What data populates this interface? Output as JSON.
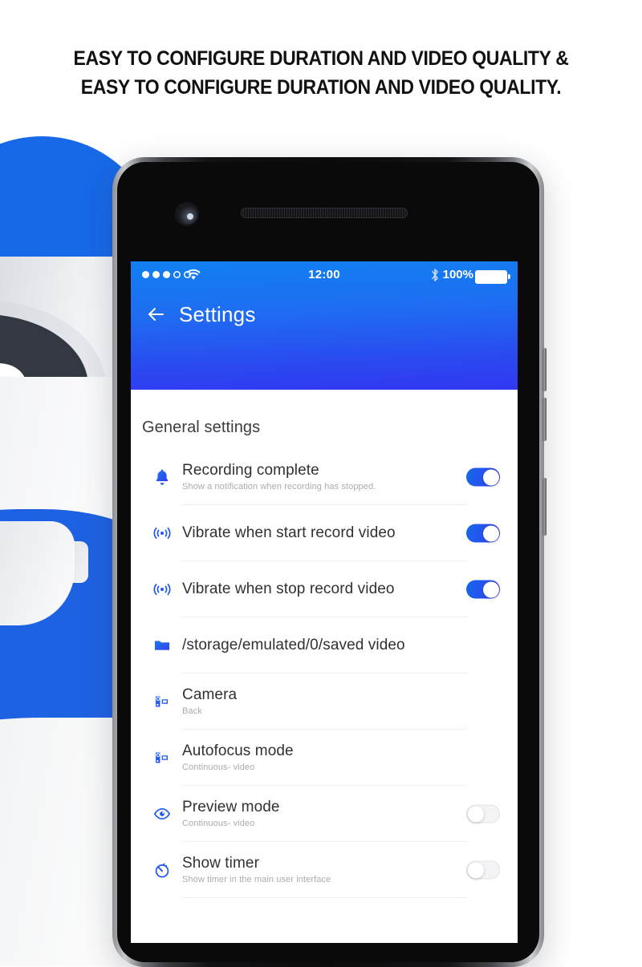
{
  "headline": {
    "line1": "EASY TO CONFIGURE DURATION AND VIDEO QUALITY &",
    "line2": "EASY TO CONFIGURE DURATION AND VIDEO QUALITY."
  },
  "colors": {
    "accent_start": "#1180f2",
    "accent_end": "#3137f2",
    "icon_blue": "#1e56ee",
    "toggle_on": "#2a4df0",
    "toggle_off": "#f3f4f6",
    "title_text": "#2f3135",
    "subtitle_text": "#a9abb0",
    "separator": "#eceef1",
    "mascot_blue": "#1769e8"
  },
  "status_bar": {
    "signal_filled": 3,
    "signal_empty": 2,
    "wifi_icon": "wifi-icon",
    "time": "12:00",
    "bluetooth_icon": "bluetooth-icon",
    "battery_percent": "100%",
    "battery_icon": "battery-full-icon"
  },
  "header": {
    "back_icon": "back-arrow-icon",
    "title": "Settings"
  },
  "settings": {
    "section_title": "General settings",
    "rows": [
      {
        "icon": "bell-icon",
        "title": "Recording complete",
        "subtitle": "Show a notification when recording has stopped.",
        "control": "toggle",
        "state": "on"
      },
      {
        "icon": "vibrate-icon",
        "title": "Vibrate when start record video",
        "subtitle": "",
        "control": "toggle",
        "state": "on"
      },
      {
        "icon": "vibrate-icon",
        "title": "Vibrate when stop record video",
        "subtitle": "",
        "control": "toggle",
        "state": "on"
      },
      {
        "icon": "folder-icon",
        "title": "/storage/emulated/0/saved video",
        "subtitle": "",
        "control": "none",
        "state": ""
      },
      {
        "icon": "camcorder-icon",
        "title": "Camera",
        "subtitle": "Back",
        "control": "none",
        "state": ""
      },
      {
        "icon": "camcorder-icon",
        "title": "Autofocus mode",
        "subtitle": "Continuous- video",
        "control": "none",
        "state": ""
      },
      {
        "icon": "eye-icon",
        "title": "Preview mode",
        "subtitle": "Continuous- video",
        "control": "toggle",
        "state": "off"
      },
      {
        "icon": "stopwatch-icon",
        "title": "Show timer",
        "subtitle": "Show timer in the main user interface",
        "control": "toggle",
        "state": "off"
      }
    ]
  }
}
